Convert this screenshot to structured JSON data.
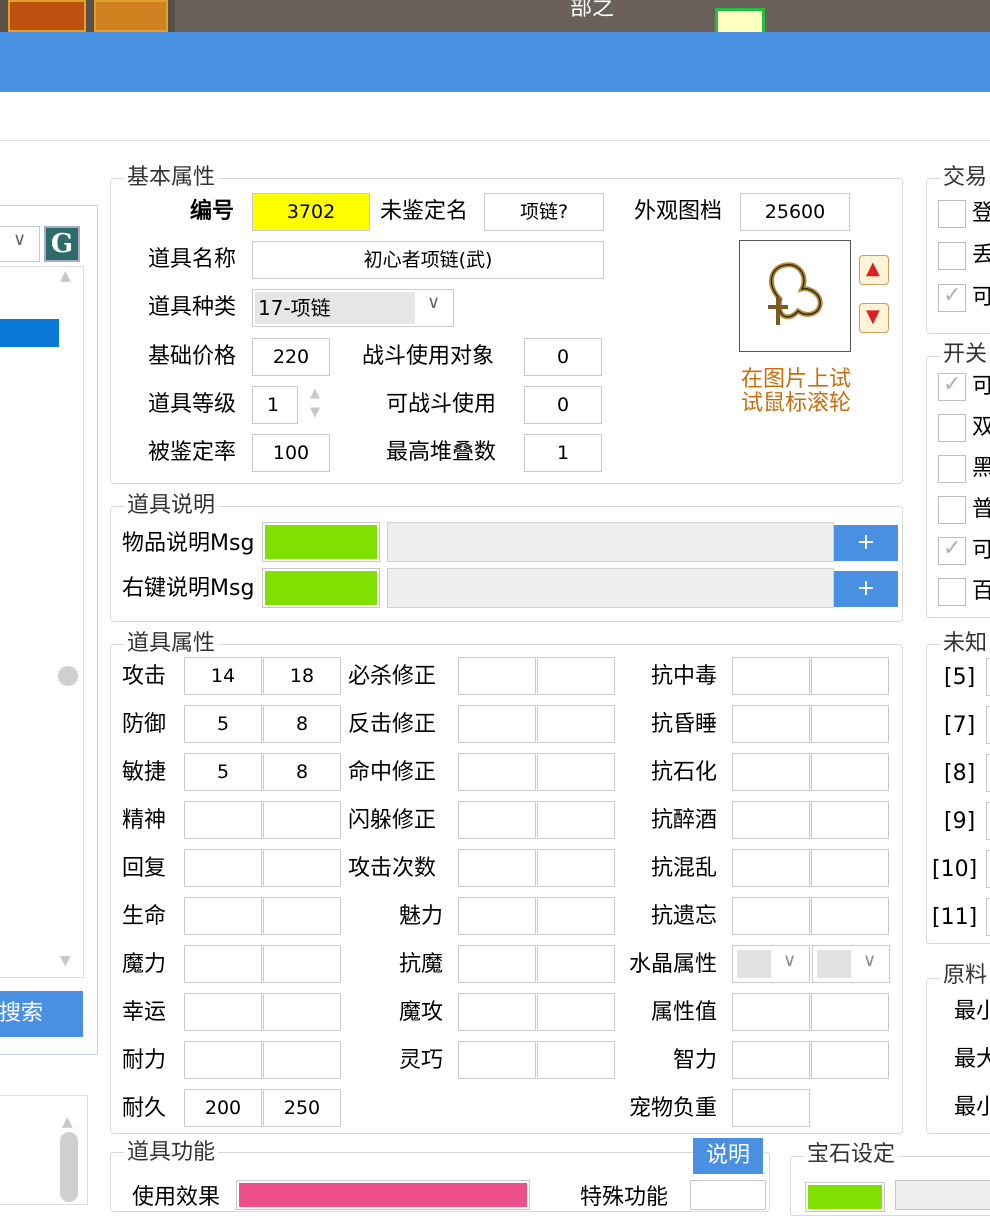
{
  "colors": {
    "accent": "#4a90e2",
    "id_highlight": "#ffff00",
    "msg_color": "#80e000",
    "func_color": "#f0508a",
    "hint": "#c87010"
  },
  "game_strip": {
    "title_fragment": "部之"
  },
  "left_panel": {
    "search_button": "搜索",
    "g_button": "G"
  },
  "basic": {
    "title": "基本属性",
    "id_label": "编号",
    "id_value": "3702",
    "unid_label": "未鉴定名",
    "unid_value": "项链?",
    "look_label": "外观图档",
    "look_value": "25600",
    "name_label": "道具名称",
    "name_value": "初心者项链(武)",
    "type_label": "道具种类",
    "type_value": "17-项链",
    "price_label": "基础价格",
    "price_value": "220",
    "target_label": "战斗使用对象",
    "target_value": "0",
    "level_label": "道具等级",
    "level_value": "1",
    "battle_label": "可战斗使用",
    "battle_value": "0",
    "ident_label": "被鉴定率",
    "ident_value": "100",
    "stack_label": "最高堆叠数",
    "stack_value": "1",
    "hint": "在图片上试试鼠标滚轮"
  },
  "desc": {
    "title": "道具说明",
    "item_label": "物品说明Msg",
    "right_label": "右键说明Msg",
    "plus": "+"
  },
  "attrs": {
    "title": "道具属性",
    "col1": [
      {
        "label": "攻击",
        "a": "14",
        "b": "18"
      },
      {
        "label": "防御",
        "a": "5",
        "b": "8"
      },
      {
        "label": "敏捷",
        "a": "5",
        "b": "8"
      },
      {
        "label": "精神",
        "a": "",
        "b": ""
      },
      {
        "label": "回复",
        "a": "",
        "b": ""
      },
      {
        "label": "生命",
        "a": "",
        "b": ""
      },
      {
        "label": "魔力",
        "a": "",
        "b": ""
      },
      {
        "label": "幸运",
        "a": "",
        "b": ""
      },
      {
        "label": "耐力",
        "a": "",
        "b": ""
      },
      {
        "label": "耐久",
        "a": "200",
        "b": "250"
      }
    ],
    "col2": [
      "必杀修正",
      "反击修正",
      "命中修正",
      "闪躲修正",
      "攻击次数",
      "魅力",
      "抗魔",
      "魔攻",
      "灵巧"
    ],
    "col3": [
      "抗中毒",
      "抗昏睡",
      "抗石化",
      "抗醉酒",
      "抗混乱",
      "抗遗忘",
      "水晶属性",
      "属性值",
      "智力",
      "宠物负重"
    ]
  },
  "func": {
    "title": "道具功能",
    "use_label": "使用效果",
    "special_label": "特殊功能",
    "explain": "说明"
  },
  "gem": {
    "title": "宝石设定"
  },
  "right": {
    "trade_title": "交易",
    "trade_items": [
      "登",
      "丢",
      "可"
    ],
    "switch_title": "开关",
    "switch_items": [
      "可",
      "双",
      "黑",
      "普",
      "可",
      "百"
    ],
    "unknown_title": "未知",
    "unknown_items": [
      "[5]",
      "[7]",
      "[8]",
      "[9]",
      "[10]",
      "[11]"
    ],
    "material_title": "原料",
    "material_items": [
      "最小",
      "最大",
      "最小"
    ]
  }
}
